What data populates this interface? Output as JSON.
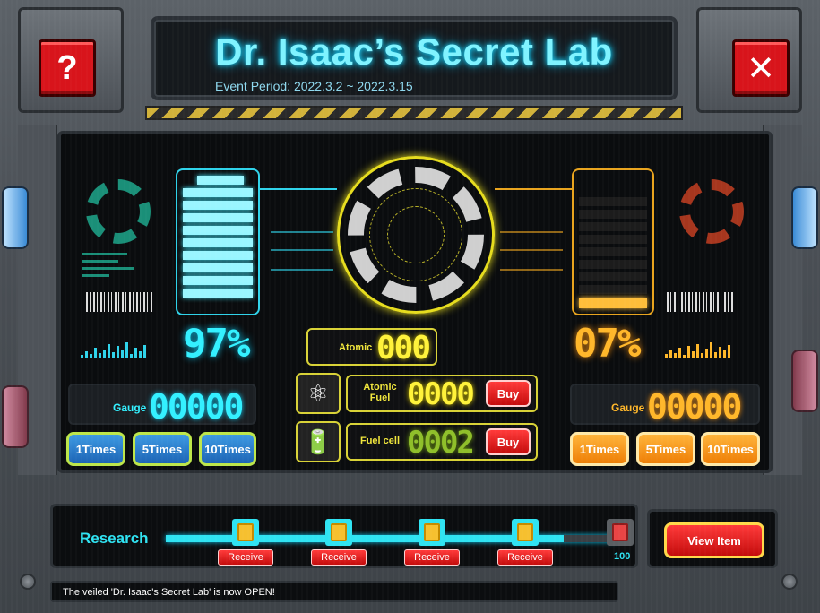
{
  "header": {
    "title": "Dr. Isaac’s Secret Lab",
    "event_period": "Event Period: 2022.3.2 ~ 2022.3.15",
    "help_label": "?",
    "close_label": "✕"
  },
  "left": {
    "percent": "97%",
    "gauge_label": "Gauge",
    "gauge_value": "00000",
    "buttons": [
      "1Times",
      "5Times",
      "10Times"
    ],
    "battery_fill": 0.97
  },
  "right": {
    "percent": "07%",
    "gauge_label": "Gauge",
    "gauge_value": "00000",
    "buttons": [
      "1Times",
      "5Times",
      "10Times"
    ],
    "battery_fill": 0.07
  },
  "center": {
    "atomic_label": "Atomic",
    "atomic_value": "000",
    "atomic_fuel_label": "Atomic Fuel",
    "atomic_fuel_value": "0000",
    "fuel_cell_label": "Fuel cell",
    "fuel_cell_value": "0002",
    "buy_label": "Buy"
  },
  "research": {
    "label": "Research",
    "receive_label": "Receive",
    "end_value": "100",
    "nodes": 4
  },
  "view_item_label": "View Item",
  "ticker": "The veiled 'Dr. Isaac's Secret Lab' is now OPEN!",
  "colors": {
    "cyan": "#33f0ff",
    "orange": "#ffb72a",
    "yellow": "#fff23a",
    "red": "#d8141b",
    "fuel_green": "#8fbf2a"
  },
  "icons": {
    "atomic_fuel": "atom-icon",
    "fuel_cell": "battery-icon",
    "reward": "card-icon"
  }
}
